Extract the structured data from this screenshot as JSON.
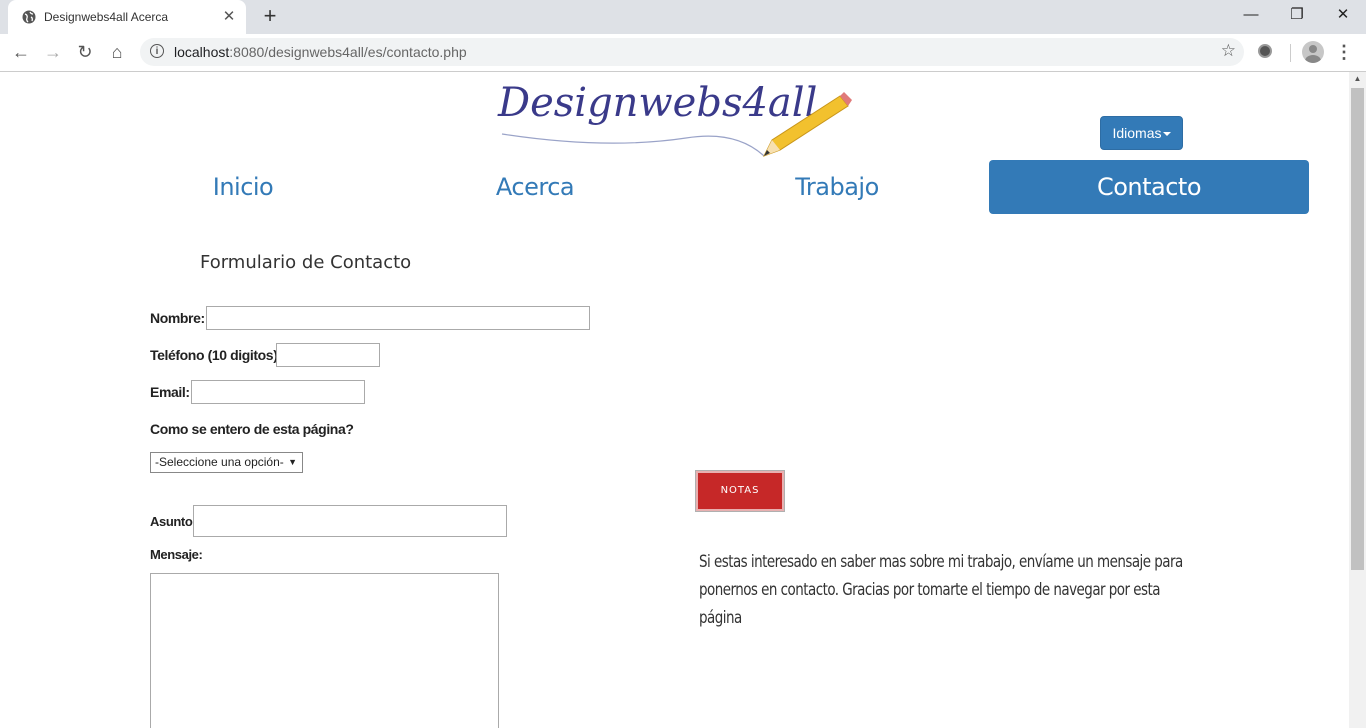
{
  "browser": {
    "tab_title": "Designwebs4all Acerca",
    "url_host": "localhost",
    "url_rest": ":8080/designwebs4all/es/contacto.php"
  },
  "site": {
    "logo_text": "Designwebs4all",
    "language_button": "Idiomas",
    "nav": [
      "Inicio",
      "Acerca",
      "Trabajo",
      "Contacto"
    ],
    "active_nav": "Contacto"
  },
  "form": {
    "title": "Formulario de Contacto",
    "name_label": "Nombre:",
    "phone_label": "Teléfono (10 digitos):",
    "email_label": "Email:",
    "source_question": "Como se entero de esta página?",
    "source_select": "-Seleccione una opción-",
    "subject_label": "Asunto:",
    "message_label": "Mensaje:"
  },
  "notes": {
    "badge": "NOTAS",
    "text": "Si estas interesado en saber mas sobre mi trabajo, envíame un mensaje para ponernos en contacto. Gracias por tomarte el tiempo de navegar por esta página"
  },
  "colors": {
    "primary": "#337ab7",
    "notas_red": "#c62828",
    "logo_blue": "#3a3a8a"
  }
}
